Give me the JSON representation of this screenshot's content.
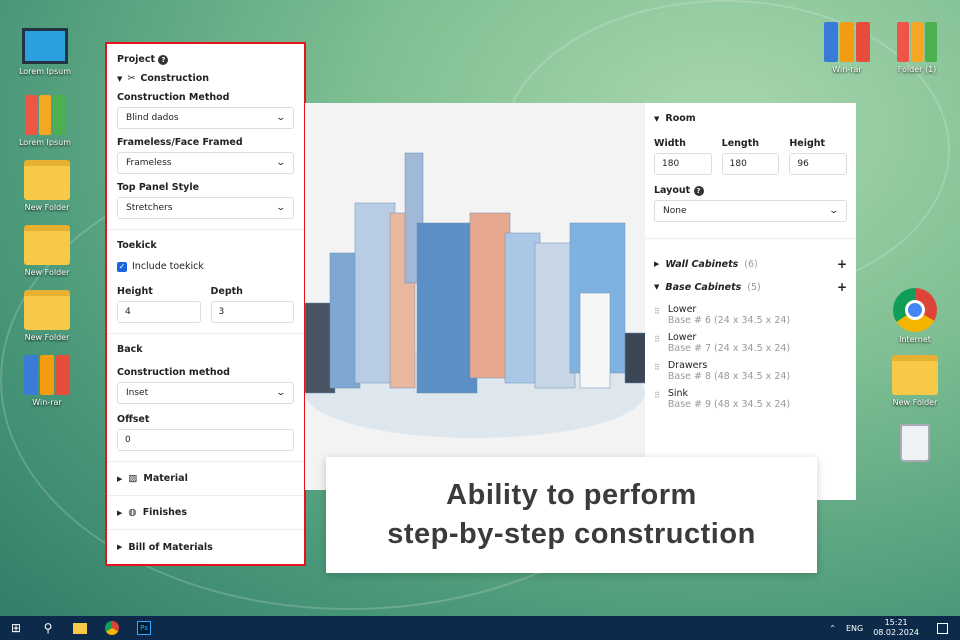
{
  "desktop": {
    "left_icons": [
      "Lorem Ipsum",
      "Lorem Ipsum",
      "New Folder",
      "New Folder",
      "New Folder",
      "Win-rar"
    ],
    "right_icons": [
      "Win-rar",
      "Folder (1)",
      "Internet",
      "New Folder"
    ]
  },
  "left_panel": {
    "project": "Project",
    "construction": "Construction",
    "construction_method_label": "Construction Method",
    "construction_method": "Blind dados",
    "frameless_label": "Frameless/Face Framed",
    "frameless": "Frameless",
    "top_panel_label": "Top Panel Style",
    "top_panel": "Stretchers",
    "toekick": "Toekick",
    "include_toekick": "Include toekick",
    "include_toekick_checked": true,
    "height_label": "Height",
    "height": "4",
    "depth_label": "Depth",
    "depth": "3",
    "back": "Back",
    "back_method_label": "Construction method",
    "back_method": "Inset",
    "offset_label": "Offset",
    "offset": "0",
    "material": "Material",
    "finishes": "Finishes",
    "bom": "Bill of Materials"
  },
  "right_panel": {
    "room": "Room",
    "width_label": "Width",
    "width": "180",
    "length_label": "Length",
    "length": "180",
    "height_label": "Height",
    "height": "96",
    "layout_label": "Layout",
    "layout": "None",
    "wall_cabinets": "Wall Cabinets",
    "wall_count": "(6)",
    "base_cabinets": "Base Cabinets",
    "base_count": "(5)",
    "cabinets": [
      {
        "name": "Lower",
        "detail": "Base # 6 (24 x 34.5 x 24)"
      },
      {
        "name": "Lower",
        "detail": "Base # 7 (24 x 34.5 x 24)"
      },
      {
        "name": "Drawers",
        "detail": "Base # 8 (48 x 34.5 x 24)"
      },
      {
        "name": "Sink",
        "detail": "Base # 9 (48 x 34.5 x 24)"
      }
    ]
  },
  "caption": {
    "line1": "Ability to perform",
    "line2": "step-by-step construction"
  },
  "taskbar": {
    "lang": "ENG",
    "time": "15:21",
    "date": "08.02.2024"
  }
}
